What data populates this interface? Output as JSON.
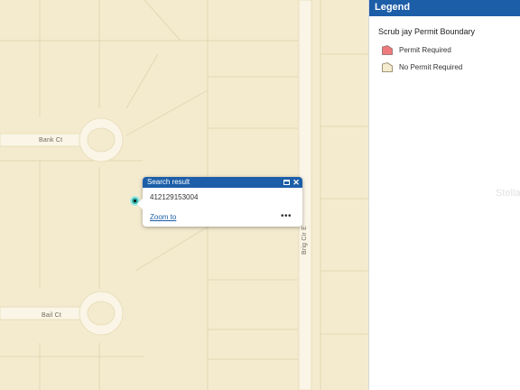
{
  "map": {
    "streets": {
      "bank": "Bank Ct",
      "bail": "Bail Ct",
      "brig": "Brig Cir E"
    },
    "colors": {
      "land": "#f4ebcf",
      "road": "#faf5e6",
      "parcel_line": "#e0d3ad"
    }
  },
  "popup": {
    "title": "Search result",
    "value": "412129153004",
    "zoom_link": "Zoom to",
    "more": "•••",
    "maximize_icon": "maximize-icon",
    "close_icon": "close-icon",
    "close_glyph": "✕"
  },
  "legend": {
    "title": "Legend",
    "layer_name": "Scrub jay Permit Boundary",
    "items": [
      {
        "label": "Permit Required",
        "color": "#ee7b7b"
      },
      {
        "label": "No Permit Required",
        "color": "#f4ebcf"
      }
    ]
  },
  "watermark": "Stellar"
}
